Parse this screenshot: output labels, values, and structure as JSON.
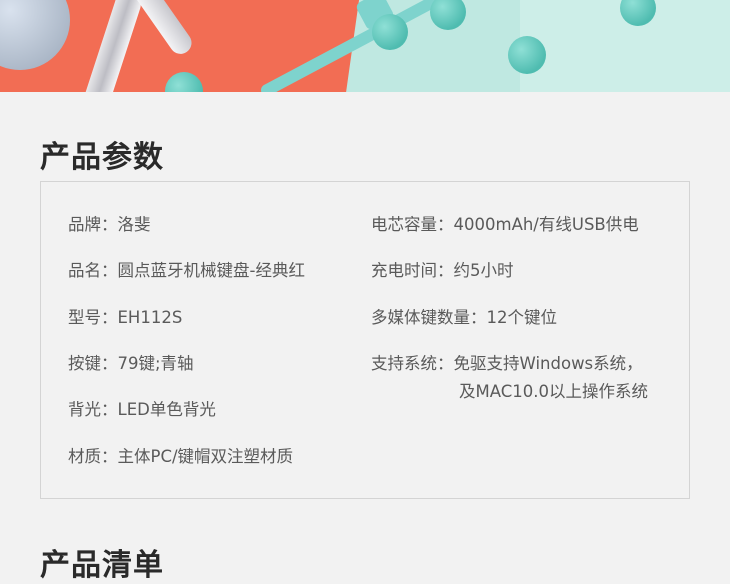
{
  "sections": {
    "params_title": "产品参数",
    "list_title": "产品清单"
  },
  "specs_left": [
    {
      "label": "品牌：",
      "value": "洛斐"
    },
    {
      "label": "品名：",
      "value": "圆点蓝牙机械键盘-经典红"
    },
    {
      "label": "型号：",
      "value": "EH112S"
    },
    {
      "label": "按键：",
      "value": "79键;青轴"
    },
    {
      "label": "背光：",
      "value": "LED单色背光"
    },
    {
      "label": "材质：",
      "value": "主体PC/键帽双注塑材质"
    }
  ],
  "specs_right": [
    {
      "label": "电芯容量：",
      "value": "4000mAh/有线USB供电"
    },
    {
      "label": "充电时间：",
      "value": "约5小时"
    },
    {
      "label": "多媒体键数量：",
      "value": "12个键位"
    },
    {
      "label": "支持系统：",
      "value": "免驱支持Windows系统，",
      "value2": "及MAC10.0以上操作系统"
    }
  ]
}
